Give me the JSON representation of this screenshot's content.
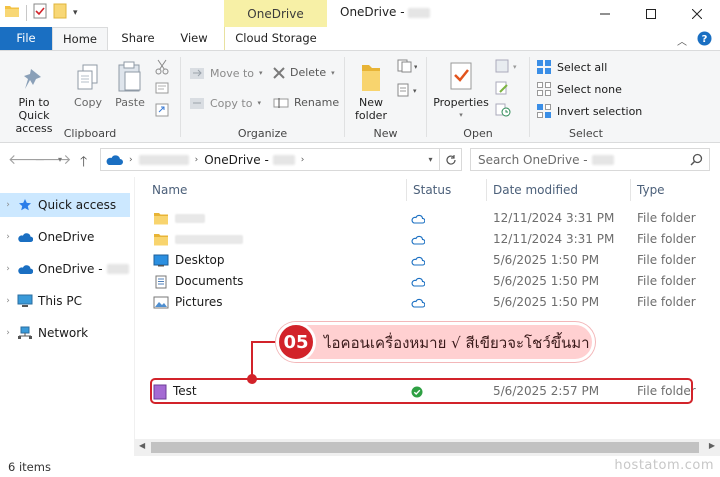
{
  "window": {
    "title": "OneDrive -",
    "context_tab": "OneDrive"
  },
  "ribbon_tabs": [
    "File",
    "Home",
    "Share",
    "View",
    "Cloud Storage"
  ],
  "ribbon": {
    "clipboard": {
      "label": "Clipboard",
      "pin": "Pin to Quick access",
      "copy": "Copy",
      "paste": "Paste"
    },
    "organize": {
      "label": "Organize",
      "move_to": "Move to",
      "copy_to": "Copy to",
      "delete": "Delete",
      "rename": "Rename"
    },
    "new": {
      "label": "New",
      "new_folder": "New folder"
    },
    "open": {
      "label": "Open",
      "properties": "Properties"
    },
    "select": {
      "label": "Select",
      "select_all": "Select all",
      "select_none": "Select none",
      "invert": "Invert selection"
    }
  },
  "address": {
    "crumbs": [
      "OneDrive -"
    ],
    "search_placeholder": "Search OneDrive -"
  },
  "nav_pane": [
    {
      "label": "Quick access",
      "selected": true,
      "icon": "star-icon"
    },
    {
      "label": "OneDrive",
      "selected": false,
      "icon": "cloud-icon"
    },
    {
      "label": "OneDrive -",
      "selected": false,
      "icon": "cloud-icon"
    },
    {
      "label": "This PC",
      "selected": false,
      "icon": "pc-icon"
    },
    {
      "label": "Network",
      "selected": false,
      "icon": "network-icon"
    }
  ],
  "columns": [
    "Name",
    "Status",
    "Date modified",
    "Type"
  ],
  "files": [
    {
      "name": "",
      "status": "cloud",
      "date": "12/11/2024 3:31 PM",
      "type": "File folder",
      "icon": "folder-icon"
    },
    {
      "name": "",
      "status": "cloud",
      "date": "12/11/2024 3:31 PM",
      "type": "File folder",
      "icon": "folder-icon"
    },
    {
      "name": "Desktop",
      "status": "cloud",
      "date": "5/6/2025 1:50 PM",
      "type": "File folder",
      "icon": "desktop-folder-icon"
    },
    {
      "name": "Documents",
      "status": "cloud",
      "date": "5/6/2025 1:50 PM",
      "type": "File folder",
      "icon": "documents-folder-icon"
    },
    {
      "name": "Pictures",
      "status": "cloud",
      "date": "5/6/2025 1:50 PM",
      "type": "File folder",
      "icon": "pictures-folder-icon"
    },
    {
      "name": "Test",
      "status": "synced",
      "date": "5/6/2025 2:57 PM",
      "type": "File folder",
      "icon": "purple-folder-icon"
    }
  ],
  "annotation": {
    "number": "05",
    "text": "ไอคอนเครื่องหมาย √ สีเขียวจะโชว์ขึ้นมา"
  },
  "status_bar": {
    "count": "6 items",
    "watermark": "hostatom.com"
  },
  "colors": {
    "accent": "#1a6fc2",
    "context_tab": "#f7f0a6",
    "highlight": "#d2232a",
    "synced": "#2ea043"
  }
}
